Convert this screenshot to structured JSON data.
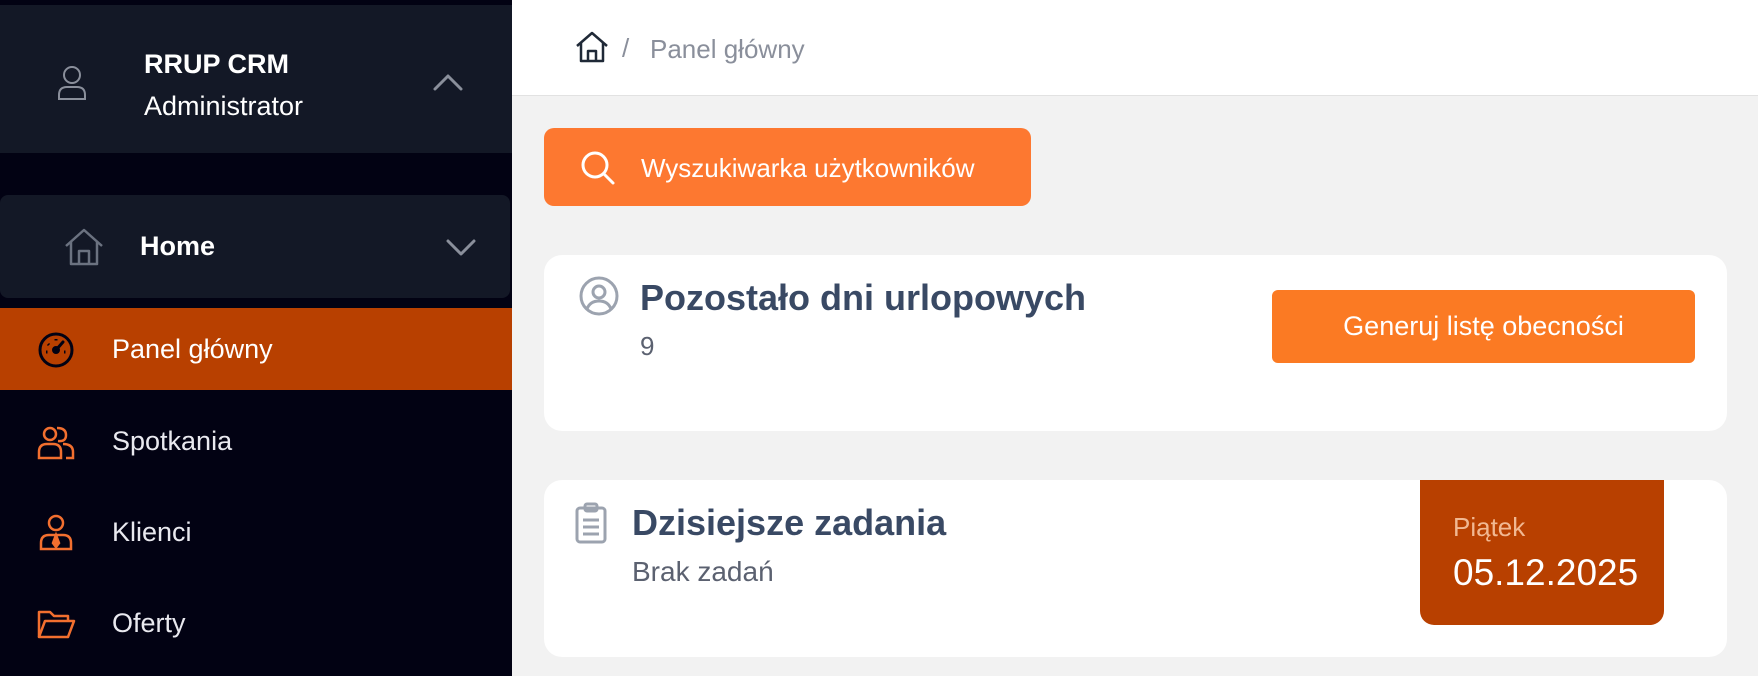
{
  "sidebar": {
    "user": {
      "name": "RRUP CRM",
      "role": "Administrator"
    },
    "section": {
      "label": "Home"
    },
    "items": [
      {
        "label": "Panel główny",
        "icon": "dashboard-icon",
        "active": true
      },
      {
        "label": "Spotkania",
        "icon": "users-icon",
        "active": false
      },
      {
        "label": "Klienci",
        "icon": "client-icon",
        "active": false
      },
      {
        "label": "Oferty",
        "icon": "folder-icon",
        "active": false
      }
    ]
  },
  "breadcrumb": {
    "separator": "/",
    "current": "Panel główny"
  },
  "search": {
    "label": "Wyszukiwarka użytkowników"
  },
  "vacation": {
    "title": "Pozostało dni urlopowych",
    "value": "9",
    "button": "Generuj listę obecności"
  },
  "tasks": {
    "title": "Dzisiejsze zadania",
    "empty": "Brak zadań"
  },
  "date": {
    "day": "Piątek",
    "value": "05.12.2025"
  },
  "colors": {
    "accent": "#fd7830",
    "active": "#b84000",
    "sidebar": "#020213",
    "sidebar_panel": "#131826"
  }
}
